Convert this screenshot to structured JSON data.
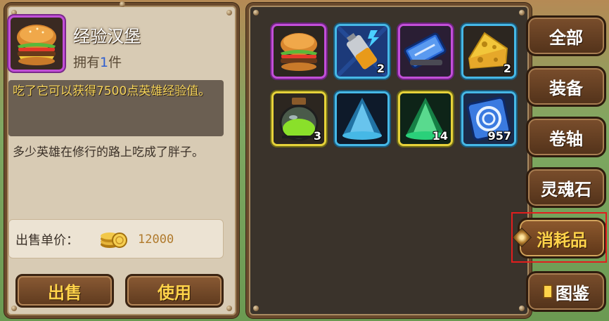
{
  "detail": {
    "item_name": "经验汉堡",
    "own_prefix": "拥有",
    "own_count": "1",
    "own_suffix": "件",
    "description": "吃了它可以获得7500点英雄经验值。",
    "flavor": "多少英雄在修行的路上吃成了胖子。",
    "price_label": "出售单价：",
    "price_value": "12000",
    "sell_button": "出售",
    "use_button": "使用"
  },
  "inventory": {
    "items": [
      {
        "icon": "burger-icon",
        "count": "",
        "rarity": "purple"
      },
      {
        "icon": "battery-icon",
        "count": "2",
        "rarity": "blue"
      },
      {
        "icon": "blue-scroll-icon",
        "count": "",
        "rarity": "purple"
      },
      {
        "icon": "cheese-icon",
        "count": "2",
        "rarity": "blue"
      },
      {
        "icon": "potion-jar-icon",
        "count": "3",
        "rarity": "yellow"
      },
      {
        "icon": "blue-dust-icon",
        "count": "",
        "rarity": "blue"
      },
      {
        "icon": "green-dust-icon",
        "count": "14",
        "rarity": "yellow"
      },
      {
        "icon": "swirl-card-icon",
        "count": "957",
        "rarity": "blue"
      }
    ]
  },
  "tabs": {
    "all": "全部",
    "equipment": "装备",
    "scrolls": "卷轴",
    "soulstones": "灵魂石",
    "consumables": "消耗品",
    "codex": "图鉴",
    "active": "consumables"
  },
  "colors": {
    "highlight_text": "#ffd34a",
    "description_text": "#f4d35a",
    "purple_rarity": "#c24fd8",
    "blue_rarity": "#46b8e6",
    "yellow_rarity": "#e6d23a",
    "selection_outline": "#e21e1e"
  }
}
